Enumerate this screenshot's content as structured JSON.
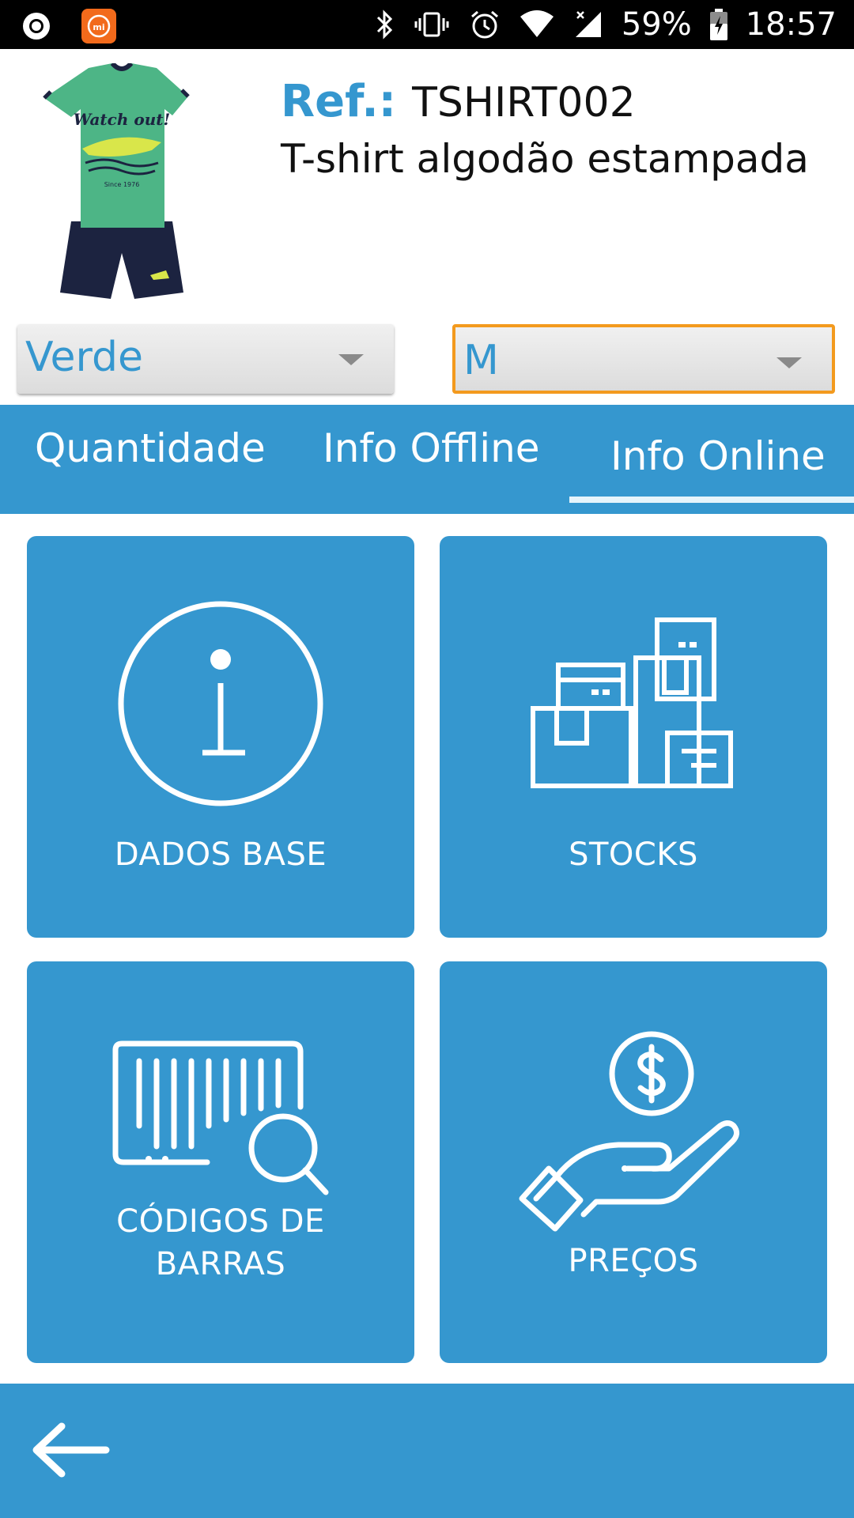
{
  "status_bar": {
    "battery_percent": "59%",
    "time": "18:57",
    "icons": [
      "record-icon",
      "mi-app-icon",
      "bluetooth-icon",
      "vibrate-icon",
      "alarm-icon",
      "wifi-icon",
      "signal-icon",
      "battery-charging-icon"
    ]
  },
  "product": {
    "ref_label": "Ref.:",
    "ref_code": "TSHIRT002",
    "name": "T-shirt algodão estampada",
    "image_icon": "product-photo-tshirt-shorts"
  },
  "selectors": {
    "color_value": "Verde",
    "size_value": "M"
  },
  "tabs": [
    {
      "label": "Quantidade",
      "active": false
    },
    {
      "label": "Info Offline",
      "active": false
    },
    {
      "label": "Info Online",
      "active": true
    }
  ],
  "tiles": [
    {
      "label": "DADOS BASE",
      "icon": "info-circle-icon"
    },
    {
      "label": "STOCKS",
      "icon": "boxes-icon"
    },
    {
      "label": "CÓDIGOS DE\nBARRAS",
      "icon": "barcode-search-icon"
    },
    {
      "label": "PREÇOS",
      "icon": "hand-coin-icon"
    }
  ],
  "bottom_bar": {
    "back_icon": "arrow-left-icon"
  },
  "colors": {
    "primary": "#3597cf",
    "accent_border": "#f39a1e",
    "status_bar": "#000000"
  }
}
